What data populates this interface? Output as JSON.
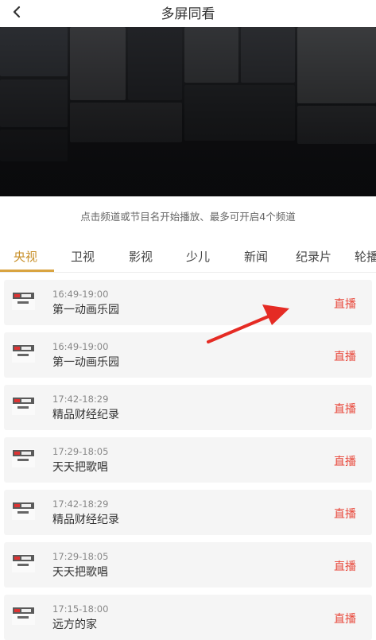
{
  "header": {
    "title": "多屏同看",
    "back_icon": "chevron-left-icon"
  },
  "banner": {
    "image": "tv-show-poster-collage"
  },
  "hint": "点击频道或节目名开始播放、最多可开启4个频道",
  "tabs": [
    {
      "label": "央视",
      "active": true
    },
    {
      "label": "卫视",
      "active": false
    },
    {
      "label": "影视",
      "active": false
    },
    {
      "label": "少儿",
      "active": false
    },
    {
      "label": "新闻",
      "active": false
    },
    {
      "label": "纪录片",
      "active": false
    },
    {
      "label": "轮播",
      "active": false
    }
  ],
  "channels": [
    {
      "logo": "cctv-logo-icon",
      "time": "16:49-19:00",
      "program": "第一动画乐园",
      "status": "直播"
    },
    {
      "logo": "cctv-logo-icon",
      "time": "16:49-19:00",
      "program": "第一动画乐园",
      "status": "直播"
    },
    {
      "logo": "cctv-logo-icon",
      "time": "17:42-18:29",
      "program": "精品财经纪录",
      "status": "直播"
    },
    {
      "logo": "cctv-logo-icon",
      "time": "17:29-18:05",
      "program": "天天把歌唱",
      "status": "直播"
    },
    {
      "logo": "cctv-logo-icon",
      "time": "17:42-18:29",
      "program": "精品财经纪录",
      "status": "直播"
    },
    {
      "logo": "cctv-logo-icon",
      "time": "17:29-18:05",
      "program": "天天把歌唱",
      "status": "直播"
    },
    {
      "logo": "cctv-logo-icon",
      "time": "17:15-18:00",
      "program": "远方的家",
      "status": "直播"
    }
  ],
  "colors": {
    "accent": "#d9a441",
    "live_text": "#e8473a",
    "annotation_arrow": "#e52b24"
  }
}
